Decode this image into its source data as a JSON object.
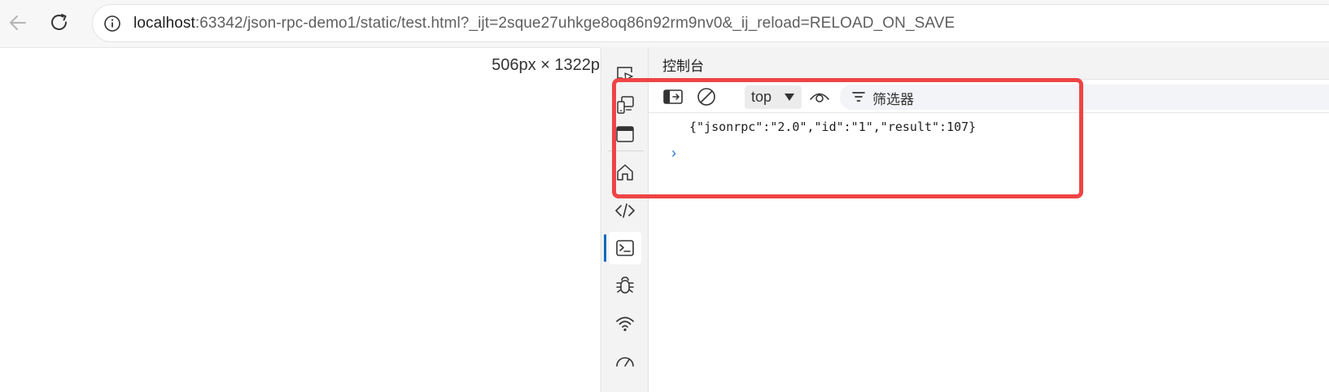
{
  "browser": {
    "url_host": "localhost",
    "url_rest": ":63342/json-rpc-demo1/static/test.html?_ijt=2sque27uhkge8oq86n92rm9nv0&_ij_reload=RELOAD_ON_SAVE",
    "icons": {
      "back": "arrow-left-icon",
      "reload": "reload-icon",
      "site_info": "info-icon"
    }
  },
  "viewport": {
    "dimensions_label": "506px × 1322p"
  },
  "devtools": {
    "activity_bar": {
      "icons": [
        "inspect-element-icon",
        "device-emulation-icon",
        "browser-window-icon",
        "home-icon",
        "elements-icon",
        "console-icon",
        "sources-debug-icon",
        "network-icon",
        "performance-icon"
      ],
      "active": "console-icon"
    },
    "panel_title": "控制台",
    "toolbar": {
      "context": "top",
      "filter_placeholder": "筛选器",
      "icons": [
        "toggle-sidebar-icon",
        "clear-console-icon",
        "dropdown-arrow-icon",
        "live-expression-eye-icon",
        "filter-icon"
      ]
    },
    "console": {
      "log_line": "{\"jsonrpc\":\"2.0\",\"id\":\"1\",\"result\":107}",
      "prompt": "›"
    }
  },
  "annotation": {
    "highlight_color": "#ef4444"
  }
}
